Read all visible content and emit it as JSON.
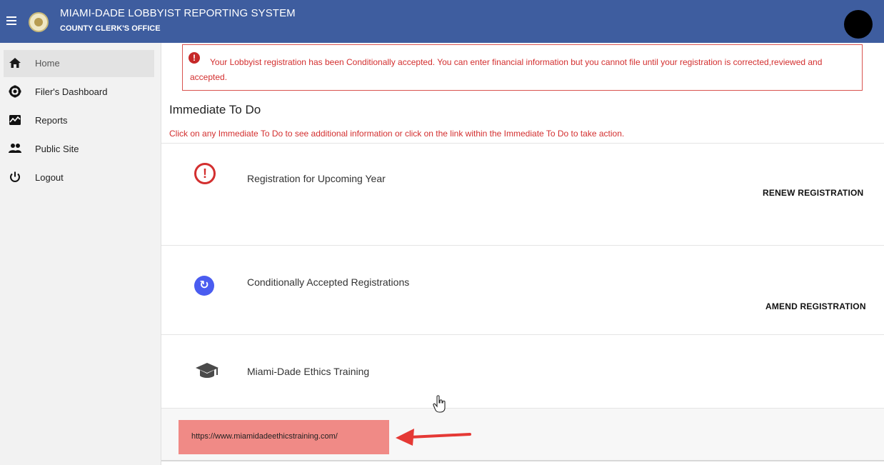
{
  "header": {
    "title": "MIAMI-DADE LOBBYIST REPORTING SYSTEM",
    "subtitle": "COUNTY CLERK'S OFFICE"
  },
  "sidebar": {
    "items": [
      {
        "label": "Home",
        "icon": "home-icon",
        "active": true
      },
      {
        "label": "Filer's Dashboard",
        "icon": "gear-icon",
        "active": false
      },
      {
        "label": "Reports",
        "icon": "reports-icon",
        "active": false
      },
      {
        "label": "Public Site",
        "icon": "people-icon",
        "active": false
      },
      {
        "label": "Logout",
        "icon": "power-icon",
        "active": false
      }
    ]
  },
  "alert": {
    "message": "Your Lobbyist registration has been Conditionally accepted. You can enter financial information but you cannot file until your registration is corrected,reviewed and accepted.",
    "color": "#d32f2f"
  },
  "todo": {
    "title": "Immediate To Do",
    "hint": "Click on any Immediate To Do to see additional information or click on the link within the Immediate To Do to take action.",
    "items": [
      {
        "title": "Registration for Upcoming Year",
        "action": "RENEW REGISTRATION",
        "icon": "warning-circle-icon"
      },
      {
        "title": "Conditionally Accepted Registrations",
        "action": "AMEND REGISTRATION",
        "icon": "redo-icon"
      },
      {
        "title": "Miami-Dade Ethics Training",
        "action": "",
        "icon": "graduation-cap-icon"
      }
    ],
    "training_link": "https://www.miamidadeethicstraining.com/"
  },
  "colors": {
    "header_bg": "#3e5d9f",
    "accent_red": "#d32f2f",
    "link_highlight": "#f08a86",
    "redo_blue": "#4a5cf0"
  }
}
